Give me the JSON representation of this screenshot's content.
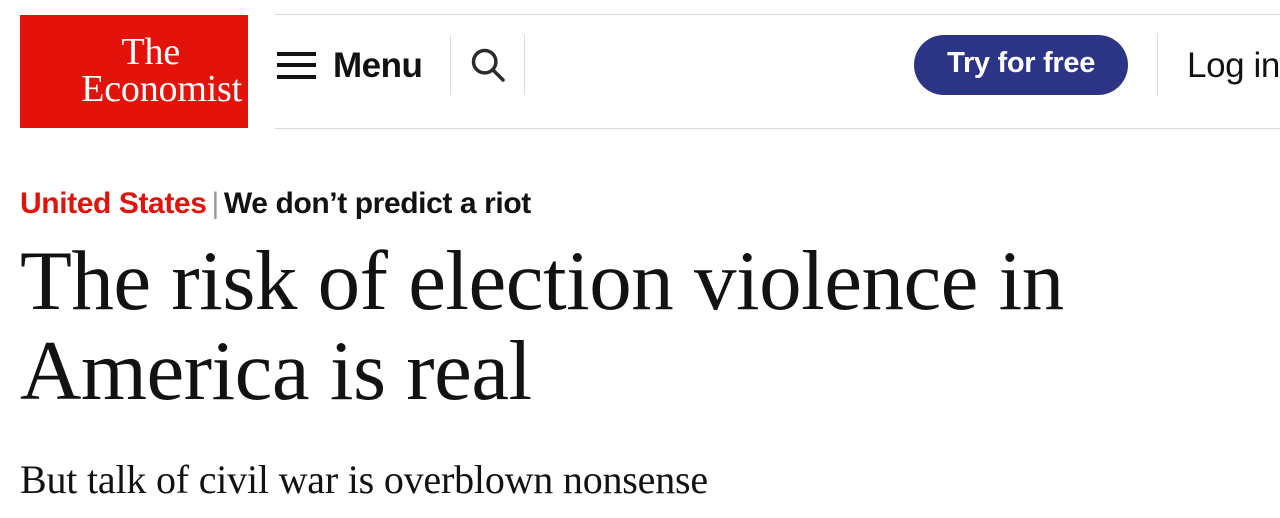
{
  "header": {
    "logo": {
      "line1": "The",
      "line2": "Economist",
      "background_color": "#E3120B"
    },
    "menu": {
      "label": "Menu",
      "icon": "hamburger-icon"
    },
    "search": {
      "icon": "search-icon"
    },
    "subscribe": {
      "label": "Try for free",
      "color": "#2C3486"
    },
    "login": {
      "label": "Log in"
    }
  },
  "article": {
    "breadcrumb": {
      "section": "United States",
      "separator": "|",
      "flytitle": "We don’t predict a riot"
    },
    "headline": "The risk of election violence in America is real",
    "subheadline": "But talk of civil war is overblown nonsense"
  }
}
